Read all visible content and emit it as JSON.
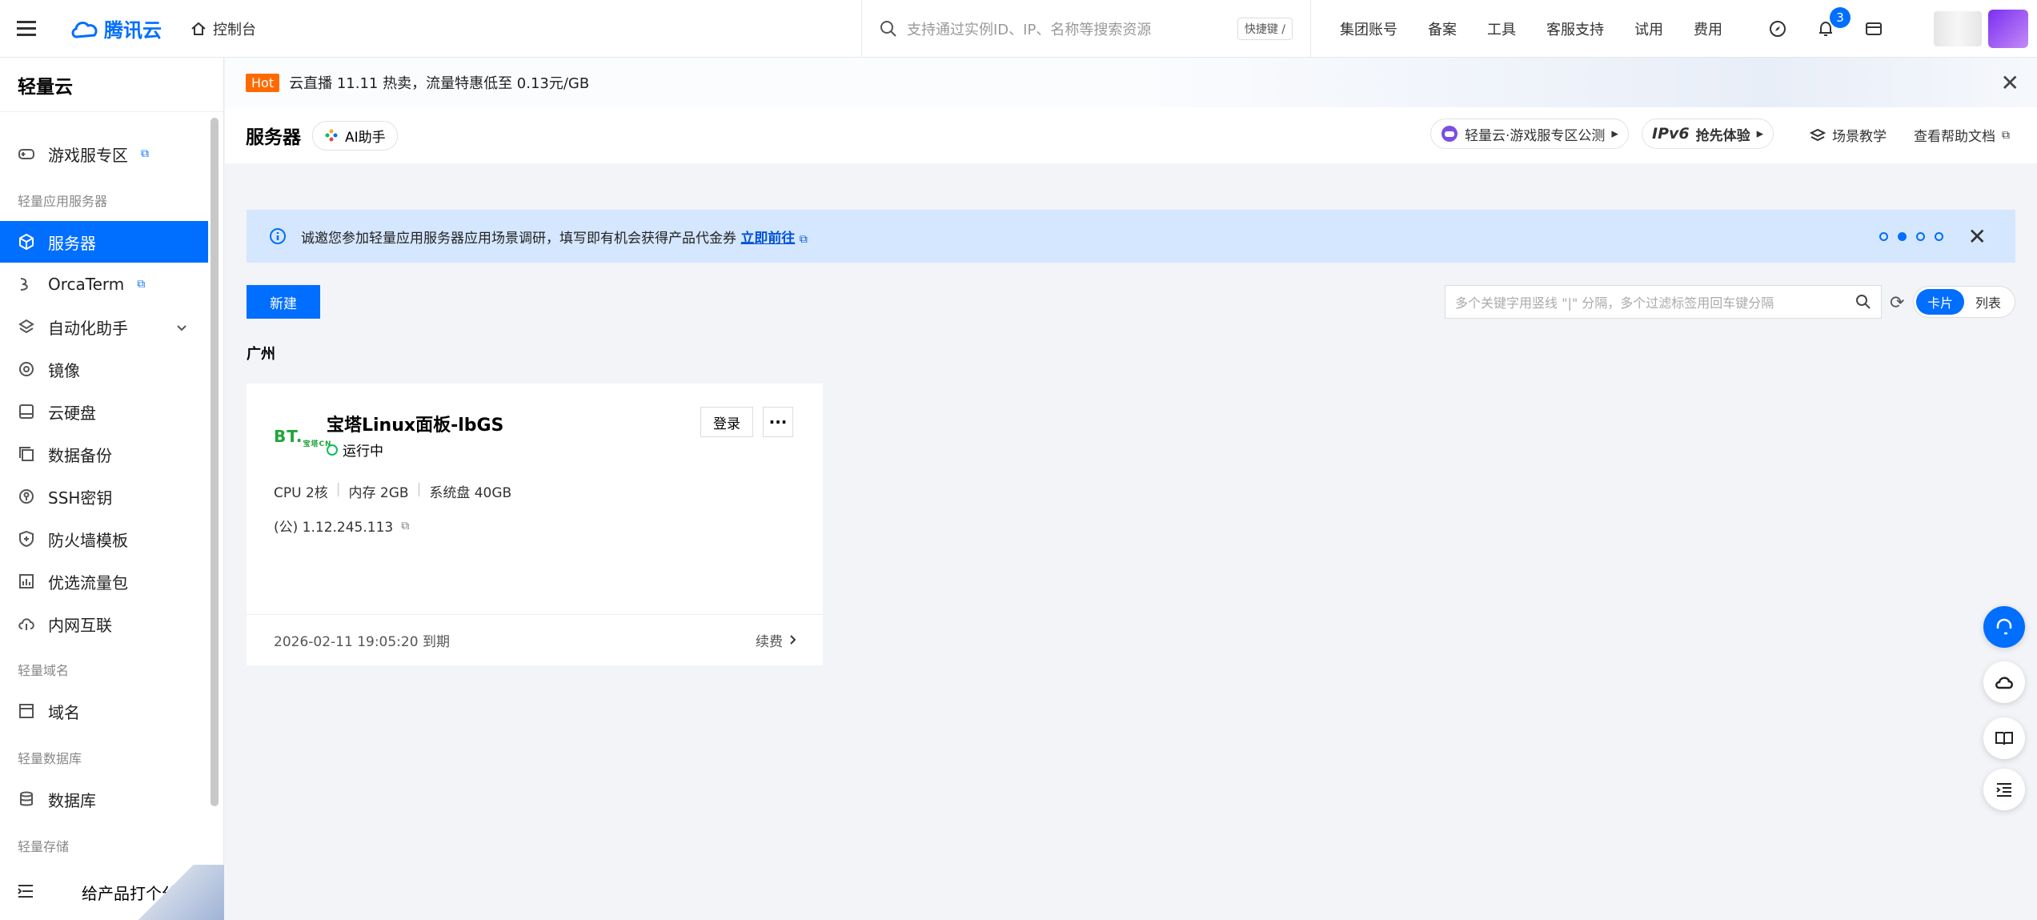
{
  "header": {
    "logo_text": "腾讯云",
    "console_label": "控制台",
    "search_placeholder": "支持通过实例ID、IP、名称等搜索资源",
    "search_shortcut": "快捷键 /",
    "links": [
      "集团账号",
      "备案",
      "工具",
      "客服支持",
      "试用",
      "费用"
    ],
    "notification_count": "3",
    "icons": [
      "compass-icon",
      "bell-icon",
      "card-icon"
    ]
  },
  "sidebar": {
    "title": "轻量云",
    "items": [
      {
        "label": "游戏服专区",
        "icon": "gamepad-icon",
        "external": true
      },
      {
        "group": "轻量应用服务器"
      },
      {
        "label": "服务器",
        "icon": "cube-icon",
        "active": true
      },
      {
        "label": "OrcaTerm",
        "icon": "terminal-icon",
        "external": true
      },
      {
        "label": "自动化助手",
        "icon": "robot-icon",
        "expandable": true
      },
      {
        "label": "镜像",
        "icon": "disc-icon"
      },
      {
        "label": "云硬盘",
        "icon": "disk-icon"
      },
      {
        "label": "数据备份",
        "icon": "backup-icon"
      },
      {
        "label": "SSH密钥",
        "icon": "key-icon"
      },
      {
        "label": "防火墙模板",
        "icon": "shield-icon"
      },
      {
        "label": "优选流量包",
        "icon": "traffic-icon"
      },
      {
        "label": "内网互联",
        "icon": "network-icon"
      },
      {
        "group": "轻量域名"
      },
      {
        "label": "域名",
        "icon": "domain-icon"
      },
      {
        "group": "轻量数据库"
      },
      {
        "label": "数据库",
        "icon": "database-icon"
      },
      {
        "group": "轻量存储"
      }
    ],
    "rate_label": "给产品打个分"
  },
  "hotbar": {
    "tag": "Hot",
    "text": "云直播 11.11 热卖，流量特惠低至 0.13元/GB"
  },
  "page": {
    "title": "服务器",
    "ai_label": "AI助手",
    "game_pill": "轻量云·游戏服专区公测",
    "ipv6_brand": "IPv6",
    "ipv6_label": "抢先体验",
    "scene_label": "场景教学",
    "help_label": "查看帮助文档"
  },
  "survey": {
    "text": "诚邀您参加轻量应用服务器应用场景调研，填写即有机会获得产品代金券",
    "link": "立即前往",
    "active_dot": 1,
    "dot_count": 4
  },
  "toolbar": {
    "new_label": "新建",
    "filter_placeholder": "多个关键字用竖线 \"|\" 分隔，多个过滤标签用回车键分隔",
    "view_card": "卡片",
    "view_list": "列表"
  },
  "region": "广州",
  "instance": {
    "logo_text": "BT.",
    "logo_sub": "宝塔CN",
    "name": "宝塔Linux面板-lbGS",
    "status": "运行中",
    "login_label": "登录",
    "more_label": "···",
    "cpu": "CPU 2核",
    "memory": "内存 2GB",
    "disk": "系统盘 40GB",
    "ip": "(公) 1.12.245.113",
    "expiry": "2026-02-11 19:05:20 到期",
    "renew_label": "续费"
  },
  "colors": {
    "primary": "#006eff",
    "hot": "#ff6a00",
    "running": "#0abf5b",
    "banner": "#d5e7ff"
  }
}
